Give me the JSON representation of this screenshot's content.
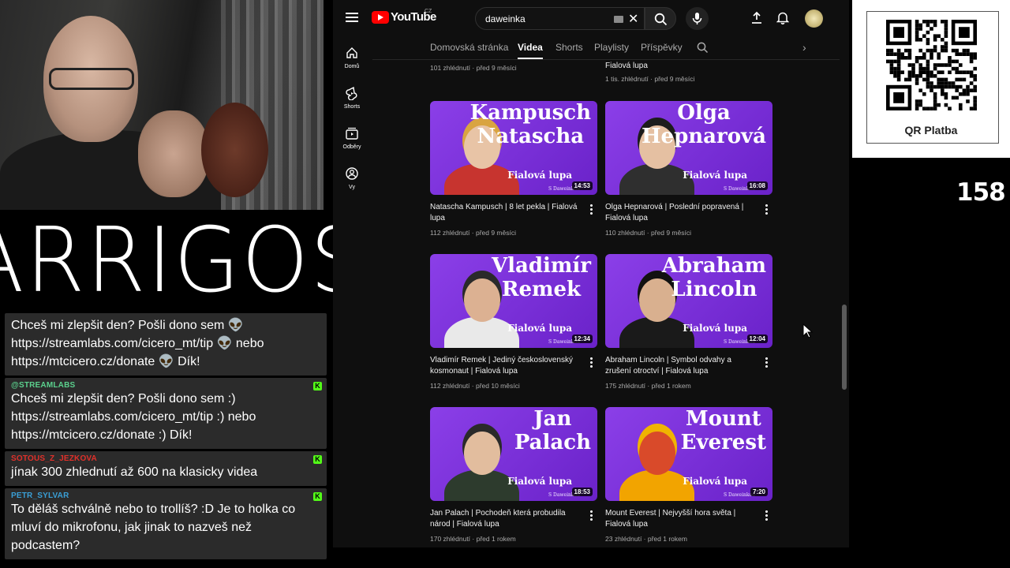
{
  "stream": {
    "channel_logo_text": "ARRIGOS",
    "counter": "158",
    "qr_label": "QR Platba"
  },
  "chat": [
    {
      "author": "",
      "author_color": "green",
      "text": "Chceš mi zlepšit den? Pošli dono sem 👽 https://streamlabs.com/cicero_mt/tip 👽 nebo https://mtcicero.cz/donate 👽 Dík!",
      "badge": ""
    },
    {
      "author": "@STREAMLABS",
      "author_color": "green",
      "text": "Chceš mi zlepšit den? Pošli dono sem :) https://streamlabs.com/cicero_mt/tip :) nebo https://mtcicero.cz/donate :) Dík!",
      "badge": "K"
    },
    {
      "author": "SOTOUS_Z_JEZKOVA",
      "author_color": "red",
      "text": "jínak 300 zhlednutí až 600 na klasicky videa",
      "badge": "K"
    },
    {
      "author": "PETR_SYLVAR",
      "author_color": "blue",
      "text": "To děláš schválně nebo to trollíš? :D Je to holka co mluví do mikrofonu, jak jinak to nazveš než podcastem?",
      "badge": "K"
    }
  ],
  "youtube": {
    "logo_text": "YouTube",
    "logo_country": "CZ",
    "search_value": "daweinka",
    "guide": [
      {
        "label": "Domů",
        "icon": "home-icon"
      },
      {
        "label": "Shorts",
        "icon": "shorts-icon"
      },
      {
        "label": "Odběry",
        "icon": "subscriptions-icon"
      },
      {
        "label": "Vy",
        "icon": "you-icon"
      }
    ],
    "tabs": [
      {
        "label": "Domovská stránka",
        "active": false
      },
      {
        "label": "Videa",
        "active": true
      },
      {
        "label": "Shorts",
        "active": false
      },
      {
        "label": "Playlisty",
        "active": false
      },
      {
        "label": "Příspěvky",
        "active": false
      }
    ],
    "partial_row": [
      {
        "title_tail": "",
        "meta": "101 zhlédnutí · před 9 měsíci"
      },
      {
        "title_tail": "Fialová lupa",
        "meta": "1 tis. zhlédnutí · před 9 měsíci"
      }
    ],
    "videos": [
      {
        "thumb_title": "Kampusch\nNatascha",
        "brand": "Fialová lupa",
        "channel_sub": "S Daweinkou",
        "duration": "14:53",
        "title": "Natascha Kampusch | 8 let pekla | Fialová lupa",
        "meta": "112 zhlédnutí · před 9 měsíci",
        "skin": "#e8c4a6",
        "hair": "#d9a441",
        "clothes": "#c7342f"
      },
      {
        "thumb_title": "Olga\nHepnarová",
        "brand": "Fialová lupa",
        "channel_sub": "S Daweinkou",
        "duration": "16:08",
        "title": "Olga Hepnarová | Poslední popravená | Fialová lupa",
        "meta": "110 zhlédnutí · před 9 měsíci",
        "skin": "#e5c0a2",
        "hair": "#1c1c1c",
        "clothes": "#2f2f2f"
      },
      {
        "thumb_title": "Vladimír\nRemek",
        "brand": "Fialová lupa",
        "channel_sub": "S Daweinkou",
        "duration": "12:34",
        "title": "Vladimír Remek | Jediný československý kosmonaut | Fialová lupa",
        "meta": "112 zhlédnutí · před 10 měsíci",
        "skin": "#dcb192",
        "hair": "#2a2a2a",
        "clothes": "#e9e9e9"
      },
      {
        "thumb_title": "Abraham\nLincoln",
        "brand": "Fialová lupa",
        "channel_sub": "S Daweinkou",
        "duration": "12:04",
        "title": "Abraham Lincoln | Symbol odvahy a zrušení otroctví | Fialová lupa",
        "meta": "175 zhlédnutí · před 1 rokem",
        "skin": "#d9b08f",
        "hair": "#111111",
        "clothes": "#1a1a1a"
      },
      {
        "thumb_title": "Jan\nPalach",
        "brand": "Fialová lupa",
        "channel_sub": "S Daweinkou",
        "duration": "18:53",
        "title": "Jan Palach | Pochodeň která probudila národ | Fialová lupa",
        "meta": "170 zhlédnutí · před 1 rokem",
        "skin": "#e2bd9e",
        "hair": "#2a2a2a",
        "clothes": "#2d3b2d"
      },
      {
        "thumb_title": "Mount\nEverest",
        "brand": "Fialová lupa",
        "channel_sub": "S Daweinkou",
        "duration": "7:20",
        "title": "Mount Everest | Nejvyšší hora světa | Fialová lupa",
        "meta": "23 zhlédnutí · před 1 rokem",
        "skin": "#d94a2a",
        "hair": "#f0b400",
        "clothes": "#f2a400"
      }
    ]
  }
}
